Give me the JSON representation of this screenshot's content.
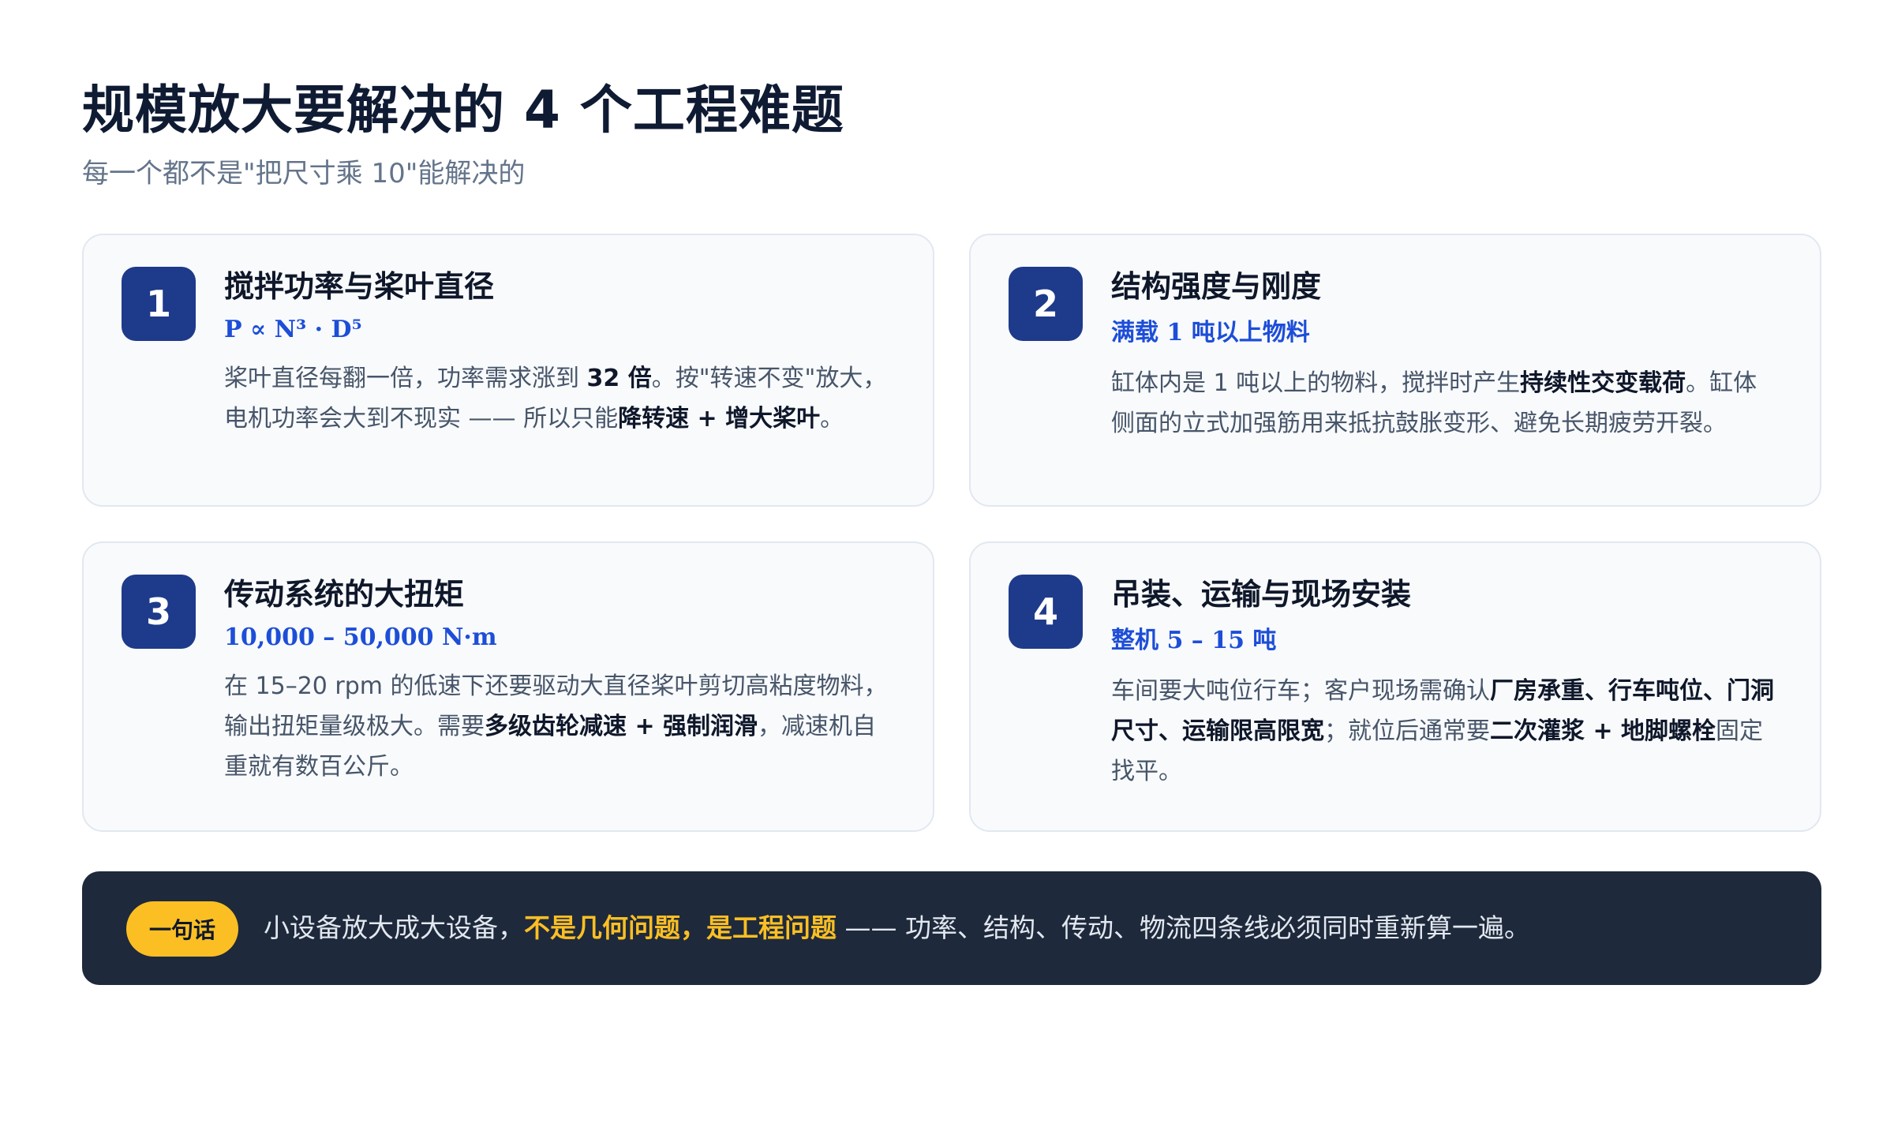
{
  "header": {
    "title": "规模放大要解决的 4 个工程难题",
    "subtitle": "每一个都不是\"把尺寸乘 10\"能解决的"
  },
  "cards": [
    {
      "number": "1",
      "title": "搅拌功率与桨叶直径",
      "tag": "P ∝ N³ · D⁵",
      "desc": [
        {
          "t": "桨叶直径每翻一倍，功率需求涨到 ",
          "b": false
        },
        {
          "t": "32 倍",
          "b": true
        },
        {
          "t": "。按\"转速不变\"放大，电机功率会大到不现实 —— 所以只能",
          "b": false
        },
        {
          "t": "降转速 + 增大桨叶",
          "b": true
        },
        {
          "t": "。",
          "b": false
        }
      ]
    },
    {
      "number": "2",
      "title": "结构强度与刚度",
      "tag": "满载 1 吨以上物料",
      "desc": [
        {
          "t": "缸体内是 1 吨以上的物料，搅拌时产生",
          "b": false
        },
        {
          "t": "持续性交变载荷",
          "b": true
        },
        {
          "t": "。缸体侧面的立式加强筋用来抵抗鼓胀变形、避免长期疲劳开裂。",
          "b": false
        }
      ]
    },
    {
      "number": "3",
      "title": "传动系统的大扭矩",
      "tag": "10,000 – 50,000 N·m",
      "desc": [
        {
          "t": "在 15–20 rpm 的低速下还要驱动大直径桨叶剪切高粘度物料，输出扭矩量级极大。需要",
          "b": false
        },
        {
          "t": "多级齿轮减速 + 强制润滑",
          "b": true
        },
        {
          "t": "，减速机自重就有数百公斤。",
          "b": false
        }
      ]
    },
    {
      "number": "4",
      "title": "吊装、运输与现场安装",
      "tag": "整机 5 – 15 吨",
      "desc": [
        {
          "t": "车间要大吨位行车；客户现场需确认",
          "b": false
        },
        {
          "t": "厂房承重、行车吨位、门洞尺寸、运输限高限宽",
          "b": true
        },
        {
          "t": "；就位后通常要",
          "b": false
        },
        {
          "t": "二次灌浆 + 地脚螺栓",
          "b": true
        },
        {
          "t": "固定找平。",
          "b": false
        }
      ]
    }
  ],
  "banner": {
    "pill": "一句话",
    "text_before": "小设备放大成大设备，",
    "highlight": "不是几何问题，是工程问题",
    "text_after": " —— 功率、结构、传动、物流四条线必须同时重新算一遍。"
  },
  "colors": {
    "accent": "#1e3a8a",
    "tag": "#1d4ed8",
    "highlight": "#fbbf24",
    "banner_bg": "#1e293b"
  }
}
